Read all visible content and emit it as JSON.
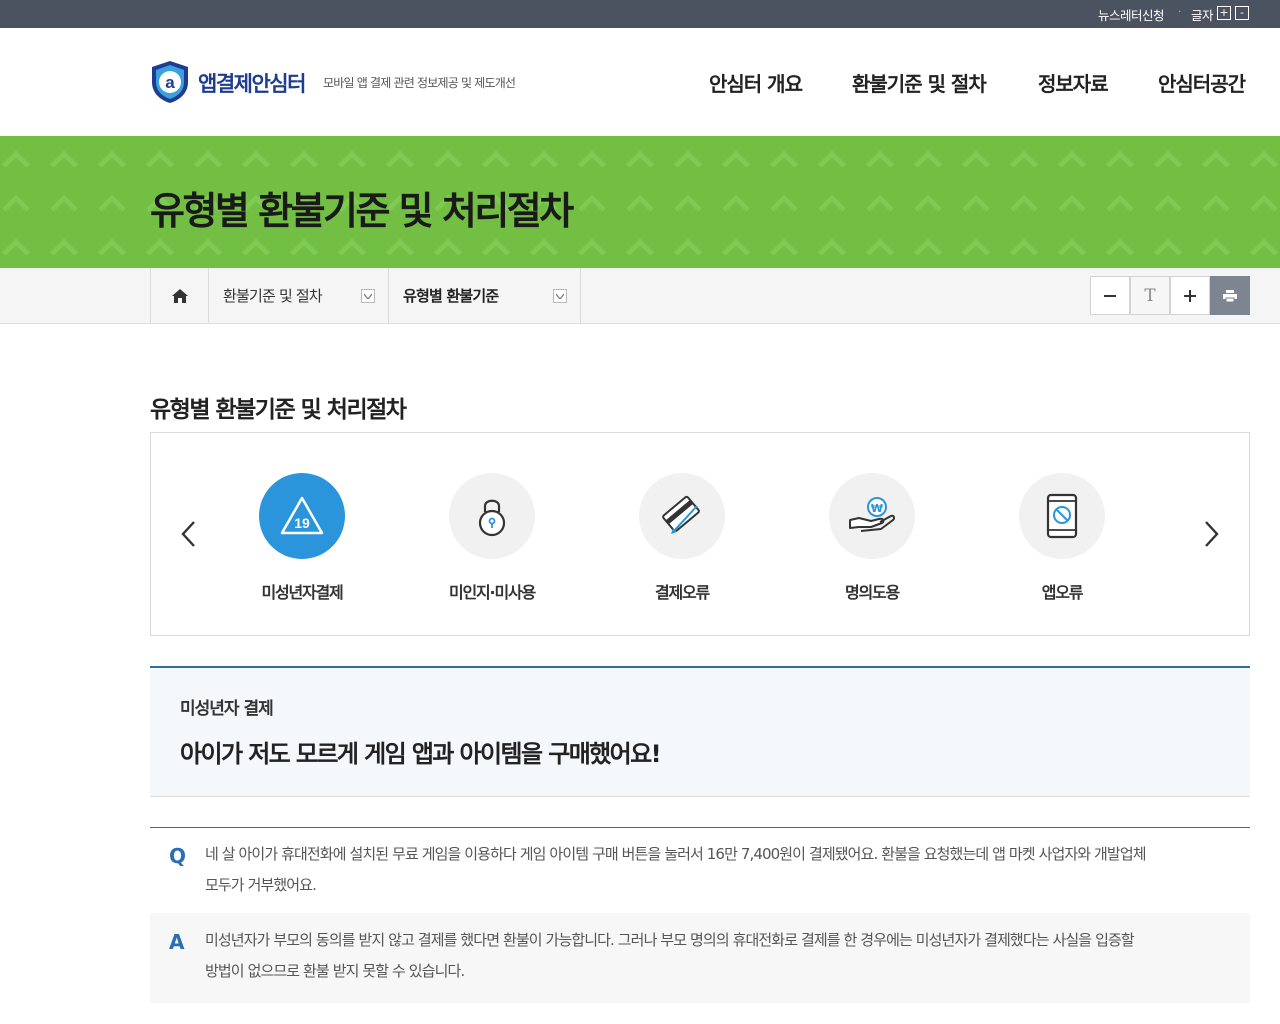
{
  "util": {
    "newsletter": "뉴스레터신청",
    "dot": "·",
    "font_label": "글자",
    "font_plus": "+",
    "font_minus": "-"
  },
  "header": {
    "logo_name": "앱결제안심터",
    "logo_sub": "모바일 앱 결제 관련 정보제공 및 제도개선",
    "nav": [
      "안심터 개요",
      "환불기준 및 절차",
      "정보자료",
      "안심터공간"
    ]
  },
  "banner": {
    "title": "유형별 환불기준 및 처리절차"
  },
  "breadcrumb": {
    "level1": "환불기준 및 절차",
    "level2": "유형별 환불기준"
  },
  "toolbar": {
    "font_reset": "T"
  },
  "section": {
    "title": "유형별 환불기준 및 처리절차"
  },
  "categories": [
    {
      "label": "미성년자결제",
      "icon": "age-19-icon",
      "active": true,
      "badge": "19"
    },
    {
      "label": "미인지·미사용",
      "icon": "lock-icon",
      "active": false
    },
    {
      "label": "결제오류",
      "icon": "card-icon",
      "active": false
    },
    {
      "label": "명의도용",
      "icon": "hand-coin-icon",
      "active": false,
      "badge": "₩"
    },
    {
      "label": "앱오류",
      "icon": "phone-blocked-icon",
      "active": false
    }
  ],
  "case": {
    "category": "미성년자 결제",
    "question_title": "아이가 저도 모르게 게임 앱과 아이템을 구매했어요!"
  },
  "qa": {
    "q_mark": "Q",
    "q_line1": "네 살 아이가 휴대전화에 설치된 무료 게임을 이용하다 게임 아이템 구매 버튼을 눌러서 16만 7,400원이 결제됐어요. 환불을 요청했는데 앱 마켓 사업자와 개발업체",
    "q_line2": "모두가 거부했어요.",
    "a_mark": "A",
    "a_line1": "미성년자가 부모의 동의를 받지 않고 결제를 했다면 환불이 가능합니다. 그러나 부모 명의의 휴대전화로 결제를 한 경우에는 미성년자가 결제했다는 사실을 입증할",
    "a_line2": "방법이 없으므로 환불 받지 못할 수 있습니다."
  },
  "colors": {
    "util_bar": "#4b5361",
    "banner_green": "#72bf44",
    "active_blue": "#2b95dc",
    "accent_line": "#2d6f9f",
    "logo_navy": "#1f3d8f"
  }
}
